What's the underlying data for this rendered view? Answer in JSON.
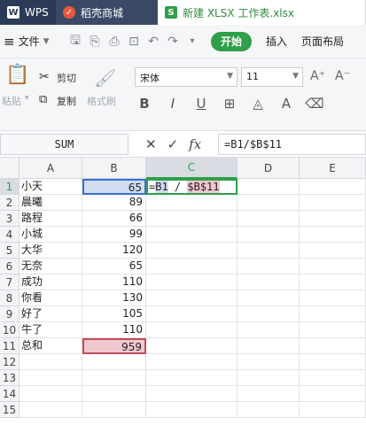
{
  "tabs": [
    {
      "icon": "wps-logo-icon",
      "label": "WPS"
    },
    {
      "icon": "daoke-shop-icon",
      "label": "稻壳商城"
    },
    {
      "icon": "spreadsheet-s-icon",
      "label": "新建 XLSX 工作表.xlsx"
    }
  ],
  "menubar": {
    "file_label": "文件",
    "start_label": "开始",
    "insert_label": "插入",
    "layout_label": "页面布局"
  },
  "ribbon": {
    "paste_label": "粘贴",
    "cut_label": "剪切",
    "copy_label": "复制",
    "format_painter_label": "格式刷",
    "font_name": "宋体",
    "font_size": "11"
  },
  "formula_bar": {
    "name_box": "SUM",
    "formula": "=B1/$B$11"
  },
  "grid": {
    "columns": [
      "A",
      "B",
      "C",
      "D",
      "E"
    ],
    "rows": [
      "1",
      "2",
      "3",
      "4",
      "5",
      "6",
      "7",
      "8",
      "9",
      "10",
      "11",
      "12",
      "13",
      "14",
      "15"
    ],
    "col_a": [
      "小天",
      "晨曦",
      "路程",
      "小城",
      "大华",
      "无奈",
      "成功",
      "你看",
      "好了",
      "牛了",
      "总和"
    ],
    "col_b": [
      "65",
      "89",
      "66",
      "99",
      "120",
      "65",
      "110",
      "130",
      "105",
      "110",
      "959"
    ],
    "edit_cell": {
      "eq": "=",
      "ref1": "B1",
      "op": " / ",
      "ref2": "$B$11"
    }
  },
  "colors": {
    "accent": "#2e9f4a",
    "ref1": "#3b6fd1",
    "ref2": "#c24b5d"
  }
}
